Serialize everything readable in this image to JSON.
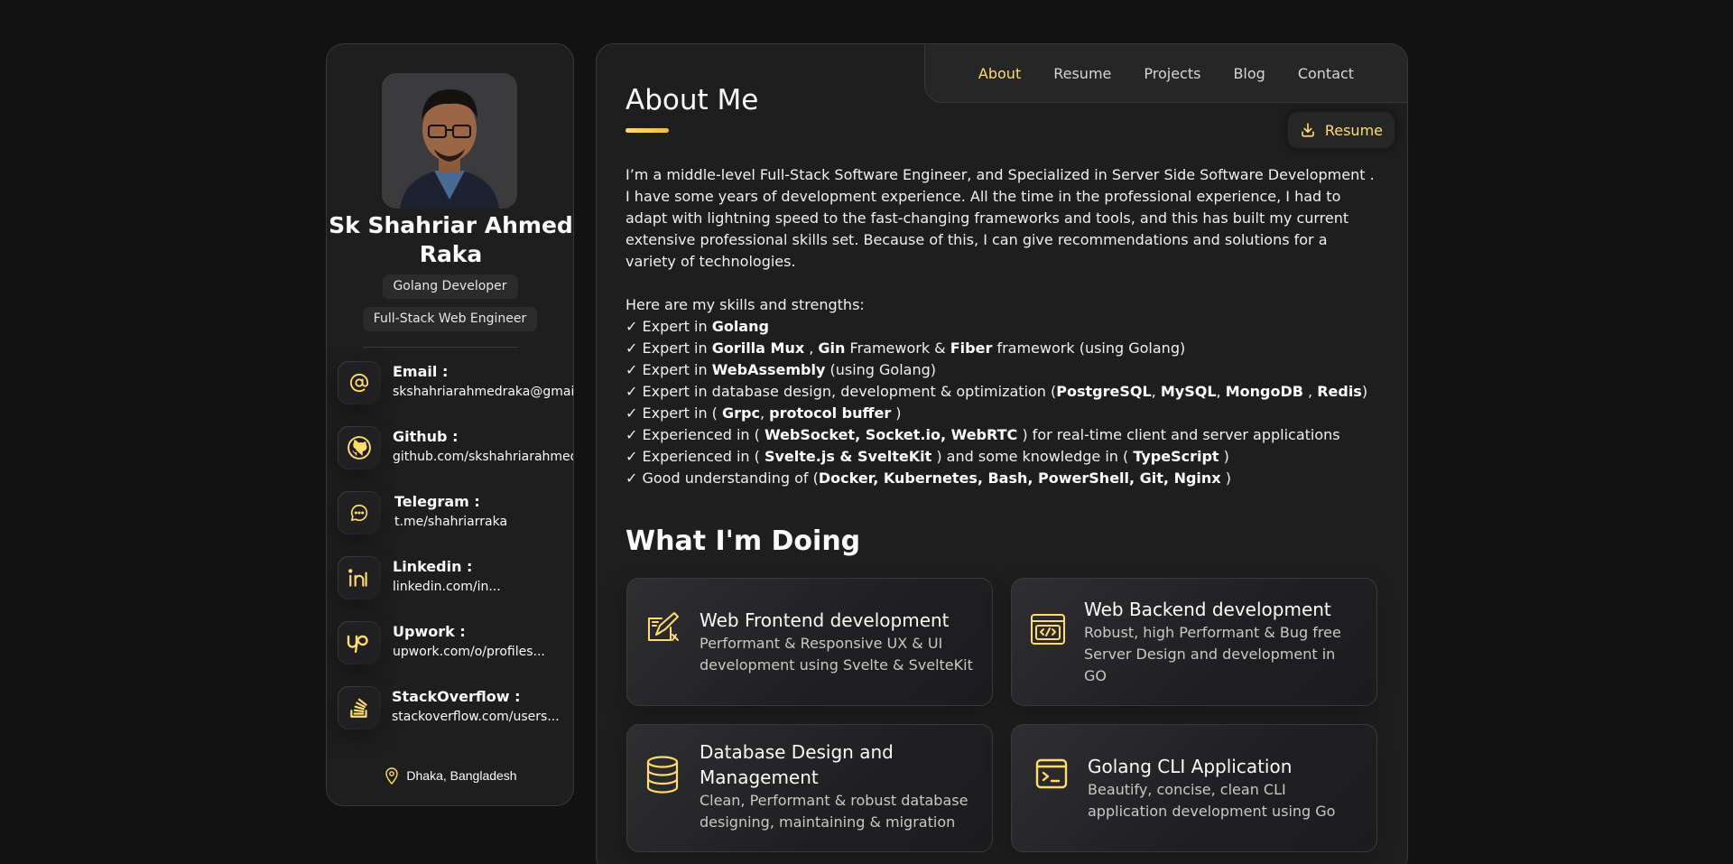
{
  "profile": {
    "name": "Sk Shahriar Ahmed Raka",
    "titles": [
      "Golang Developer",
      "Full-Stack Web Engineer"
    ],
    "location": "Dhaka, Bangladesh"
  },
  "contacts": [
    {
      "label": "Email :",
      "value": "skshahriarahmedraka@gmail.com",
      "icon": "at-icon"
    },
    {
      "label": "Github :",
      "value": "github.com/skshahriarahmedraka",
      "icon": "github-icon"
    },
    {
      "label": "Telegram :",
      "value": "t.me/shahriarraka",
      "icon": "chat-icon"
    },
    {
      "label": "Linkedin :",
      "value": "linkedin.com/in...",
      "icon": "linkedin-icon"
    },
    {
      "label": "Upwork :",
      "value": "upwork.com/o/profiles...",
      "icon": "upwork-icon"
    },
    {
      "label": "StackOverflow :",
      "value": "stackoverflow.com/users...",
      "icon": "stackoverflow-icon"
    }
  ],
  "nav": {
    "items": [
      "About",
      "Resume",
      "Projects",
      "Blog",
      "Contact"
    ],
    "active": "About"
  },
  "main": {
    "title": "About Me",
    "resume_button": "Resume",
    "intro": "I’m a middle-level Full-Stack Software Engineer, and Specialized in Server Side Software Development . I have some years of development experience. All the time in the professional experience, I had to adapt with lightning speed to the fast-changing frameworks and tools, and this has built my current extensive professional skills set. Because of this, I can give recommendations and solutions for a variety of technologies.",
    "skills_heading": "Here are my skills and strengths:",
    "skills": [
      [
        {
          "t": "✓ Expert in "
        },
        {
          "t": "Golang",
          "b": true
        }
      ],
      [
        {
          "t": "✓ Expert in "
        },
        {
          "t": "Gorilla Mux",
          "b": true
        },
        {
          "t": " , "
        },
        {
          "t": "Gin",
          "b": true
        },
        {
          "t": " Framework & "
        },
        {
          "t": "Fiber",
          "b": true
        },
        {
          "t": " framework (using Golang)"
        }
      ],
      [
        {
          "t": "✓ Expert in "
        },
        {
          "t": "WebAssembly",
          "b": true
        },
        {
          "t": " (using Golang)"
        }
      ],
      [
        {
          "t": "✓ Expert in database design, development & optimization ("
        },
        {
          "t": "PostgreSQL",
          "b": true
        },
        {
          "t": ", "
        },
        {
          "t": "MySQL",
          "b": true
        },
        {
          "t": ", "
        },
        {
          "t": "MongoDB",
          "b": true
        },
        {
          "t": " , "
        },
        {
          "t": "Redis",
          "b": true
        },
        {
          "t": ")"
        }
      ],
      [
        {
          "t": "✓ Expert in ( "
        },
        {
          "t": "Grpc",
          "b": true
        },
        {
          "t": ", "
        },
        {
          "t": "protocol buffer",
          "b": true
        },
        {
          "t": " )"
        }
      ],
      [
        {
          "t": "✓ Experienced in ( "
        },
        {
          "t": "WebSocket, Socket.io, WebRTC",
          "b": true
        },
        {
          "t": " ) for real-time client and server applications"
        }
      ],
      [
        {
          "t": "✓ Experienced in ( "
        },
        {
          "t": "Svelte.js & SvelteKit",
          "b": true
        },
        {
          "t": " ) and some knowledge in ( "
        },
        {
          "t": "TypeScript",
          "b": true
        },
        {
          "t": " )"
        }
      ],
      [
        {
          "t": "✓ Good understanding of ("
        },
        {
          "t": "Docker, Kubernetes, Bash, PowerShell, Git, Nginx",
          "b": true
        },
        {
          "t": " )"
        }
      ]
    ],
    "doing_title": "What I'm Doing",
    "services": [
      {
        "title": "Web Frontend development",
        "desc": "Performant & Responsive UX & UI development using Svelte & SvelteKit",
        "icon": "design-pen-icon"
      },
      {
        "title": "Web Backend development",
        "desc": "Robust, high Performant & Bug free Server Design and development in GO",
        "icon": "code-window-icon"
      },
      {
        "title": "Database Design and Management",
        "desc": "Clean, Performant & robust database designing, maintaining & migration",
        "icon": "database-icon"
      },
      {
        "title": "Golang CLI Application",
        "desc": "Beautify, concise, clean CLI application development using Go",
        "icon": "terminal-icon"
      }
    ]
  },
  "colors": {
    "accent": "#ffdb70",
    "background": "#121212",
    "card": "#1e1e1f"
  }
}
